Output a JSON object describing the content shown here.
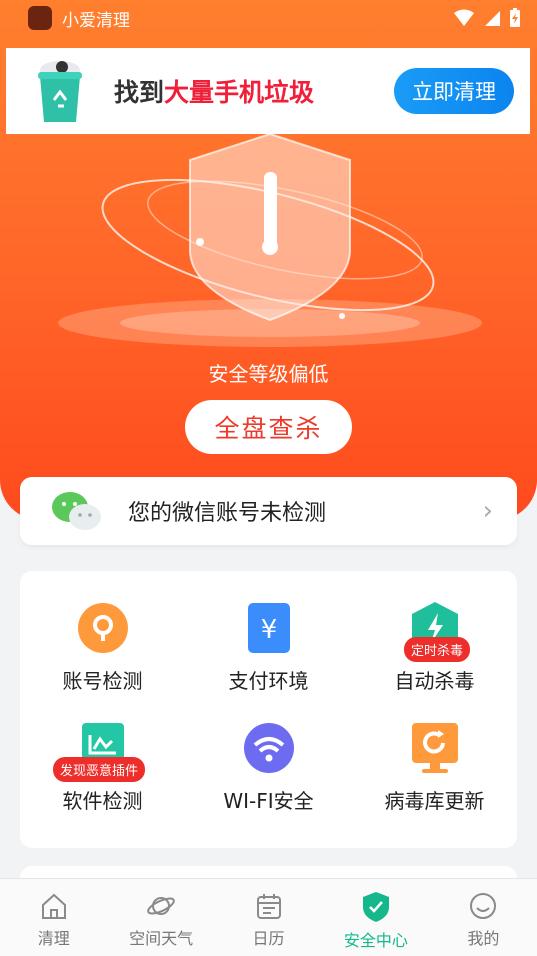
{
  "status_bar": {
    "app_name": "小爱清理"
  },
  "ad": {
    "text_prefix": "找到",
    "text_highlight": "大量手机垃圾",
    "button_label": "立即清理"
  },
  "security": {
    "level_text": "安全等级偏低",
    "scan_button_label": "全盘查杀"
  },
  "wechat": {
    "text": "您的微信账号未检测"
  },
  "features": [
    {
      "label": "账号检测",
      "badge": ""
    },
    {
      "label": "支付环境",
      "badge": ""
    },
    {
      "label": "自动杀毒",
      "badge": "定时杀毒"
    },
    {
      "label": "软件检测",
      "badge": "发现恶意插件"
    },
    {
      "label": "WI-FI安全",
      "badge": ""
    },
    {
      "label": "病毒库更新",
      "badge": ""
    }
  ],
  "tabbar": {
    "items": [
      {
        "label": "清理",
        "icon": "home-icon"
      },
      {
        "label": "空间天气",
        "icon": "planet-icon"
      },
      {
        "label": "日历",
        "icon": "calendar-icon"
      },
      {
        "label": "安全中心",
        "icon": "shield-check-icon",
        "active": true
      },
      {
        "label": "我的",
        "icon": "smile-icon"
      }
    ]
  },
  "colors": {
    "hero_orange": "#ff6a2a",
    "accent_red": "#f0203a",
    "accent_blue": "#0b84ef",
    "tab_active": "#14b88a"
  }
}
